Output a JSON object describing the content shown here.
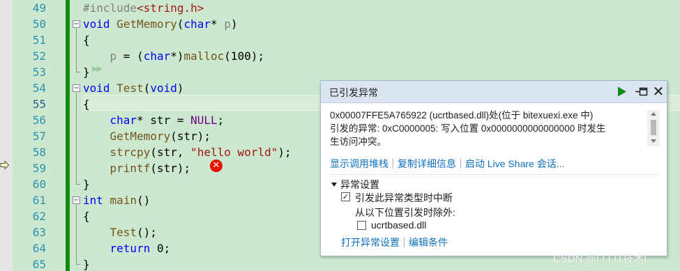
{
  "editor": {
    "line_numbers": [
      "49",
      "50",
      "51",
      "52",
      "53",
      "54",
      "55",
      "56",
      "57",
      "58",
      "59",
      "60",
      "61",
      "62",
      "63",
      "64",
      "65"
    ],
    "lines": [
      {
        "parts": [
          {
            "t": "#include",
            "c": "pp"
          },
          {
            "t": "<string.h>",
            "c": "str"
          }
        ]
      },
      {
        "parts": [
          {
            "t": "void",
            "c": "kw"
          },
          {
            "t": " "
          },
          {
            "t": "GetMemory",
            "c": "fn"
          },
          {
            "t": "("
          },
          {
            "t": "char",
            "c": "kw"
          },
          {
            "t": "* "
          },
          {
            "t": "p",
            "c": "par"
          },
          {
            "t": ")"
          }
        ]
      },
      {
        "parts": [
          {
            "t": "{"
          }
        ]
      },
      {
        "parts": [
          {
            "t": "    "
          },
          {
            "t": "p",
            "c": "par"
          },
          {
            "t": " = ("
          },
          {
            "t": "char",
            "c": "kw"
          },
          {
            "t": "*)"
          },
          {
            "t": "malloc",
            "c": "fn"
          },
          {
            "t": "(100);"
          }
        ]
      },
      {
        "parts": [
          {
            "t": "}"
          }
        ]
      },
      {
        "parts": [
          {
            "t": "void",
            "c": "kw"
          },
          {
            "t": " "
          },
          {
            "t": "Test",
            "c": "fn"
          },
          {
            "t": "("
          },
          {
            "t": "void",
            "c": "kw"
          },
          {
            "t": ")"
          }
        ]
      },
      {
        "parts": [
          {
            "t": "{"
          }
        ]
      },
      {
        "parts": [
          {
            "t": "    "
          },
          {
            "t": "char",
            "c": "kw"
          },
          {
            "t": "* str = "
          },
          {
            "t": "NULL",
            "c": "null"
          },
          {
            "t": ";"
          }
        ]
      },
      {
        "parts": [
          {
            "t": "    "
          },
          {
            "t": "GetMemory",
            "c": "fn"
          },
          {
            "t": "(str);"
          }
        ]
      },
      {
        "parts": [
          {
            "t": "    "
          },
          {
            "t": "strcpy",
            "c": "fn"
          },
          {
            "t": "(str, "
          },
          {
            "t": "\"hello world\"",
            "c": "str"
          },
          {
            "t": ");"
          }
        ]
      },
      {
        "parts": [
          {
            "t": "    "
          },
          {
            "t": "printf",
            "c": "fn"
          },
          {
            "t": "(str);"
          }
        ]
      },
      {
        "parts": [
          {
            "t": "}"
          }
        ]
      },
      {
        "parts": [
          {
            "t": "int",
            "c": "kw"
          },
          {
            "t": " "
          },
          {
            "t": "main",
            "c": "fn"
          },
          {
            "t": "()"
          }
        ]
      },
      {
        "parts": [
          {
            "t": "{"
          }
        ]
      },
      {
        "parts": [
          {
            "t": "    "
          },
          {
            "t": "Test",
            "c": "fn"
          },
          {
            "t": "();"
          }
        ]
      },
      {
        "parts": [
          {
            "t": "    "
          },
          {
            "t": "return",
            "c": "kw"
          },
          {
            "t": " 0;"
          }
        ]
      },
      {
        "parts": [
          {
            "t": "}"
          }
        ]
      }
    ],
    "current_line_number": "55",
    "execution_line_number": "59",
    "error_icon": "error-x-icon",
    "exec_icon": "next-statement-arrow-icon"
  },
  "exception_popup": {
    "title": "已引发异常",
    "message_line1": "0x00007FFE5A765922 (ucrtbased.dll)处(位于 bitexuexi.exe 中)",
    "message_line2": "引发的异常: 0xC0000005: 写入位置 0x0000000000000000 时发生",
    "message_line3": "生访问冲突。",
    "links": [
      "显示调用堆栈",
      "复制详细信息",
      "启动 Live Share 会话..."
    ],
    "settings_header": "异常设置",
    "break_option_label": "引发此异常类型时中断",
    "break_option_checked": true,
    "except_label": "从以下位置引发时除外:",
    "except_option_label": "ucrtbased.dll",
    "except_option_checked": false,
    "bottom_links": [
      "打开异常设置",
      "编辑条件"
    ],
    "continue_icon": "play-icon",
    "dock_icon": "dock-pin-icon",
    "close_icon": "close-icon"
  },
  "watermark": "CSDN @I I I IT技术I",
  "colors": {
    "editor_bg": "#cce8cf",
    "keyword": "#0000ff",
    "string": "#a31515",
    "function": "#74531f",
    "line_number": "#2b91af",
    "change_bar": "#108a10",
    "link": "#0e70c0",
    "popup_header": "#dae5f1",
    "continue_green": "#0e8a16"
  }
}
